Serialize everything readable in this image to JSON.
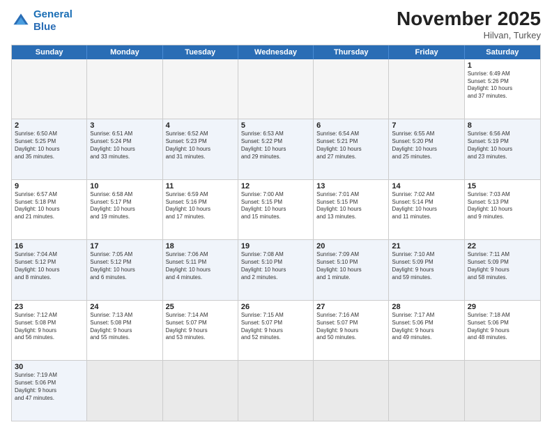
{
  "header": {
    "logo_line1": "General",
    "logo_line2": "Blue",
    "month_title": "November 2025",
    "location": "Hilvan, Turkey"
  },
  "days_of_week": [
    "Sunday",
    "Monday",
    "Tuesday",
    "Wednesday",
    "Thursday",
    "Friday",
    "Saturday"
  ],
  "weeks": [
    [
      {
        "day": "",
        "text": ""
      },
      {
        "day": "",
        "text": ""
      },
      {
        "day": "",
        "text": ""
      },
      {
        "day": "",
        "text": ""
      },
      {
        "day": "",
        "text": ""
      },
      {
        "day": "",
        "text": ""
      },
      {
        "day": "1",
        "text": "Sunrise: 6:49 AM\nSunset: 5:26 PM\nDaylight: 10 hours\nand 37 minutes."
      }
    ],
    [
      {
        "day": "2",
        "text": "Sunrise: 6:50 AM\nSunset: 5:25 PM\nDaylight: 10 hours\nand 35 minutes."
      },
      {
        "day": "3",
        "text": "Sunrise: 6:51 AM\nSunset: 5:24 PM\nDaylight: 10 hours\nand 33 minutes."
      },
      {
        "day": "4",
        "text": "Sunrise: 6:52 AM\nSunset: 5:23 PM\nDaylight: 10 hours\nand 31 minutes."
      },
      {
        "day": "5",
        "text": "Sunrise: 6:53 AM\nSunset: 5:22 PM\nDaylight: 10 hours\nand 29 minutes."
      },
      {
        "day": "6",
        "text": "Sunrise: 6:54 AM\nSunset: 5:21 PM\nDaylight: 10 hours\nand 27 minutes."
      },
      {
        "day": "7",
        "text": "Sunrise: 6:55 AM\nSunset: 5:20 PM\nDaylight: 10 hours\nand 25 minutes."
      },
      {
        "day": "8",
        "text": "Sunrise: 6:56 AM\nSunset: 5:19 PM\nDaylight: 10 hours\nand 23 minutes."
      }
    ],
    [
      {
        "day": "9",
        "text": "Sunrise: 6:57 AM\nSunset: 5:18 PM\nDaylight: 10 hours\nand 21 minutes."
      },
      {
        "day": "10",
        "text": "Sunrise: 6:58 AM\nSunset: 5:17 PM\nDaylight: 10 hours\nand 19 minutes."
      },
      {
        "day": "11",
        "text": "Sunrise: 6:59 AM\nSunset: 5:16 PM\nDaylight: 10 hours\nand 17 minutes."
      },
      {
        "day": "12",
        "text": "Sunrise: 7:00 AM\nSunset: 5:15 PM\nDaylight: 10 hours\nand 15 minutes."
      },
      {
        "day": "13",
        "text": "Sunrise: 7:01 AM\nSunset: 5:15 PM\nDaylight: 10 hours\nand 13 minutes."
      },
      {
        "day": "14",
        "text": "Sunrise: 7:02 AM\nSunset: 5:14 PM\nDaylight: 10 hours\nand 11 minutes."
      },
      {
        "day": "15",
        "text": "Sunrise: 7:03 AM\nSunset: 5:13 PM\nDaylight: 10 hours\nand 9 minutes."
      }
    ],
    [
      {
        "day": "16",
        "text": "Sunrise: 7:04 AM\nSunset: 5:12 PM\nDaylight: 10 hours\nand 8 minutes."
      },
      {
        "day": "17",
        "text": "Sunrise: 7:05 AM\nSunset: 5:12 PM\nDaylight: 10 hours\nand 6 minutes."
      },
      {
        "day": "18",
        "text": "Sunrise: 7:06 AM\nSunset: 5:11 PM\nDaylight: 10 hours\nand 4 minutes."
      },
      {
        "day": "19",
        "text": "Sunrise: 7:08 AM\nSunset: 5:10 PM\nDaylight: 10 hours\nand 2 minutes."
      },
      {
        "day": "20",
        "text": "Sunrise: 7:09 AM\nSunset: 5:10 PM\nDaylight: 10 hours\nand 1 minute."
      },
      {
        "day": "21",
        "text": "Sunrise: 7:10 AM\nSunset: 5:09 PM\nDaylight: 9 hours\nand 59 minutes."
      },
      {
        "day": "22",
        "text": "Sunrise: 7:11 AM\nSunset: 5:09 PM\nDaylight: 9 hours\nand 58 minutes."
      }
    ],
    [
      {
        "day": "23",
        "text": "Sunrise: 7:12 AM\nSunset: 5:08 PM\nDaylight: 9 hours\nand 56 minutes."
      },
      {
        "day": "24",
        "text": "Sunrise: 7:13 AM\nSunset: 5:08 PM\nDaylight: 9 hours\nand 55 minutes."
      },
      {
        "day": "25",
        "text": "Sunrise: 7:14 AM\nSunset: 5:07 PM\nDaylight: 9 hours\nand 53 minutes."
      },
      {
        "day": "26",
        "text": "Sunrise: 7:15 AM\nSunset: 5:07 PM\nDaylight: 9 hours\nand 52 minutes."
      },
      {
        "day": "27",
        "text": "Sunrise: 7:16 AM\nSunset: 5:07 PM\nDaylight: 9 hours\nand 50 minutes."
      },
      {
        "day": "28",
        "text": "Sunrise: 7:17 AM\nSunset: 5:06 PM\nDaylight: 9 hours\nand 49 minutes."
      },
      {
        "day": "29",
        "text": "Sunrise: 7:18 AM\nSunset: 5:06 PM\nDaylight: 9 hours\nand 48 minutes."
      }
    ],
    [
      {
        "day": "30",
        "text": "Sunrise: 7:19 AM\nSunset: 5:06 PM\nDaylight: 9 hours\nand 47 minutes."
      },
      {
        "day": "",
        "text": ""
      },
      {
        "day": "",
        "text": ""
      },
      {
        "day": "",
        "text": ""
      },
      {
        "day": "",
        "text": ""
      },
      {
        "day": "",
        "text": ""
      },
      {
        "day": "",
        "text": ""
      }
    ]
  ]
}
